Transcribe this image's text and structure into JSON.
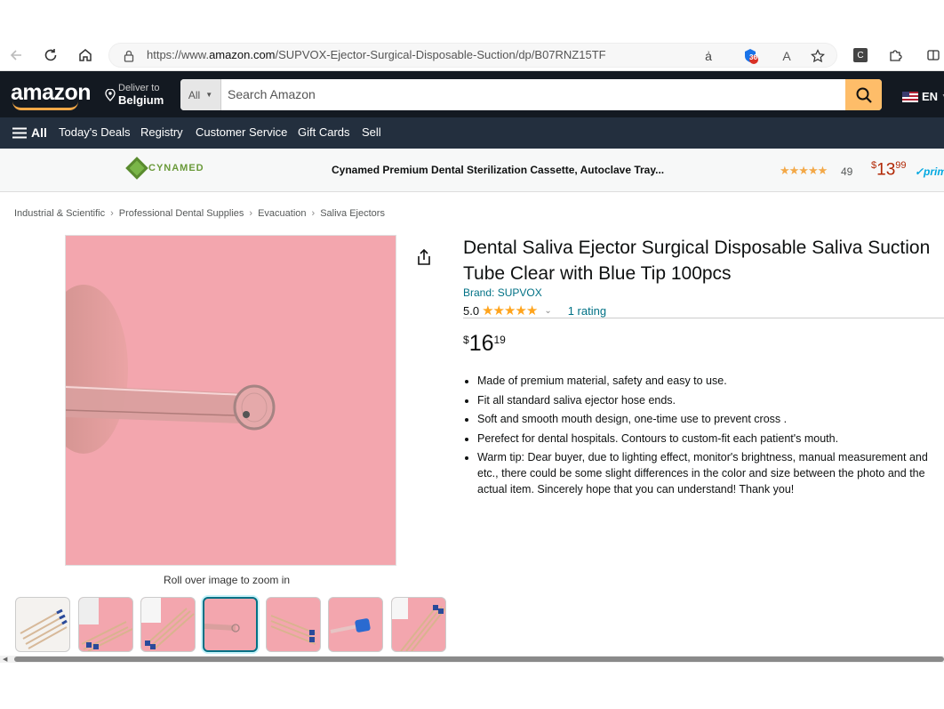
{
  "browser": {
    "url": "https://www.amazon.com/SUPVOX-Ejector-Surgical-Disposable-Suction/dp/B07RNZ15TF",
    "url_prefix": "https://www.",
    "url_host": "amazon.com",
    "url_path": "/SUPVOX-Ejector-Surgical-Disposable-Suction/dp/B07RNZ15TF",
    "translate_glyph": "ẚ",
    "extension_badge": "36",
    "read_aloud_glyph": "A",
    "ext_c_glyph": "C"
  },
  "header": {
    "logo": "amazon",
    "deliver_line1": "Deliver to",
    "deliver_line2": "Belgium",
    "search_scope": "All",
    "search_placeholder": "Search Amazon",
    "language": "EN"
  },
  "subnav": {
    "all_label": "All",
    "items": [
      "Today's Deals",
      "Registry",
      "Customer Service",
      "Gift Cards",
      "Sell"
    ]
  },
  "sponsored": {
    "brand_logo_text": "CYNAMED",
    "title": "Cynamed Premium Dental Sterilization Cassette, Autoclave Tray...",
    "stars": "★★★★★",
    "rating_count": "49",
    "price_currency": "$",
    "price_whole": "13",
    "price_fraction": "99",
    "prime": "✓prime"
  },
  "breadcrumb": [
    "Industrial & Scientific",
    "Professional Dental Supplies",
    "Evacuation",
    "Saliva Ejectors"
  ],
  "gallery": {
    "zoom_hint": "Roll over image to zoom in",
    "thumbnail_count": 7,
    "selected_index": 3
  },
  "product": {
    "title": "Dental Saliva Ejector Surgical Disposable Saliva Suction Tube Clear with Blue Tip 100pcs",
    "brand": "Brand: SUPVOX",
    "rating_value": "5.0",
    "stars": "★★★★★",
    "rating_link": "1 rating",
    "price_currency": "$",
    "price_whole": "16",
    "price_fraction": "19",
    "bullets": [
      "Made of premium material, safety and easy to use.",
      "Fit all standard saliva ejector hose ends.",
      "Soft and smooth mouth design, one-time use to prevent cross .",
      "Perefect for dental hospitals. Contours to custom-fit each patient's mouth.",
      "Warm tip: Dear buyer, due to lighting effect, monitor's brightness, manual measurement and etc., there could be some slight differences in the color and size between the photo and the actual item. Sincerely hope that you can understand! Thank you!"
    ]
  },
  "colors": {
    "nav_bg": "#131921",
    "subnav_bg": "#232f3e",
    "search_button": "#febd69",
    "link": "#007185",
    "price_red": "#b12704",
    "star": "#ffa41c",
    "image_bg": "#f3a6ae"
  }
}
